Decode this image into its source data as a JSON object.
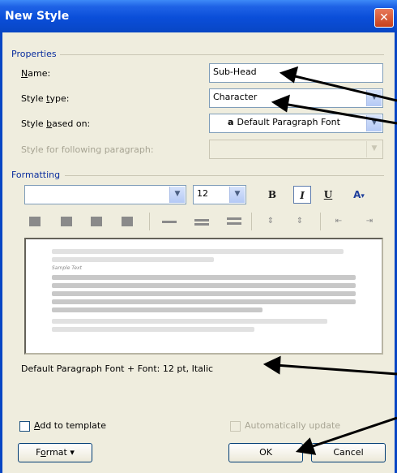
{
  "window": {
    "title": "New Style",
    "close_glyph": "✕"
  },
  "properties": {
    "section_label": "Properties",
    "name_label_pre": "",
    "name_label_u": "N",
    "name_label_post": "ame:",
    "name_value": "Sub-Head",
    "style_type_label_pre": "Style ",
    "style_type_label_u": "t",
    "style_type_label_post": "ype:",
    "style_type_value": "Character",
    "based_on_label_pre": "Style ",
    "based_on_label_u": "b",
    "based_on_label_post": "ased on:",
    "based_on_value": "Default Paragraph Font",
    "based_on_icon": "a",
    "following_label": "Style for following paragraph:",
    "following_value": ""
  },
  "formatting": {
    "section_label": "Formatting",
    "font_value": "",
    "size_value": "12",
    "bold_label": "B",
    "italic_label": "I",
    "underline_label": "U",
    "font_color_label": "A",
    "description": "Default Paragraph Font + Font: 12 pt, Italic",
    "preview_sample": "Sample Text"
  },
  "footer": {
    "add_template_pre": "",
    "add_template_u": "A",
    "add_template_post": "dd to template",
    "auto_update_label": "Automatically update",
    "format_pre": "F",
    "format_u": "o",
    "format_post": "rmat ▾",
    "ok_label": "OK",
    "cancel_label": "Cancel"
  },
  "icons": [
    "close-icon",
    "chevron-down-icon",
    "align-left-icon",
    "align-center-icon",
    "align-right-icon",
    "justify-icon",
    "line-spacing-icon",
    "paragraph-spacing-icon",
    "indent-icon",
    "character-style-icon"
  ]
}
